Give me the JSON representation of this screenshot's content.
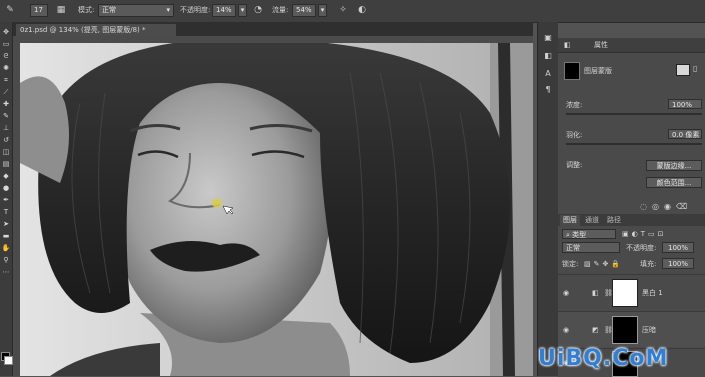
{
  "options_bar": {
    "brush_size": "17",
    "mode_label": "模式:",
    "mode_value": "正常",
    "opacity_label": "不透明度:",
    "opacity_value": "14%",
    "flow_label": "流量:",
    "flow_value": "54%"
  },
  "document": {
    "tab_title": "0z1.psd @ 134% (提亮, 图层蒙版/8) *"
  },
  "properties": {
    "tab_label": "属性",
    "mask_type": "图层蒙版",
    "density_label": "浓度:",
    "density_value": "100%",
    "feather_label": "羽化:",
    "feather_value": "0.0 像素",
    "adjust_label": "调整:",
    "mask_edge_button": "蒙版边缘...",
    "color_range_button": "颜色范围..."
  },
  "layers": {
    "tabs": [
      "图层",
      "通道",
      "路径"
    ],
    "filter_label": "类型",
    "blend_mode": "正常",
    "opacity_label": "不透明度:",
    "opacity_value": "100%",
    "lock_label": "锁定:",
    "fill_label": "填充:",
    "fill_value": "100%",
    "items": [
      {
        "name": "黑白 1"
      },
      {
        "name": "压暗"
      }
    ]
  },
  "watermark": "UiBQ.CoM"
}
